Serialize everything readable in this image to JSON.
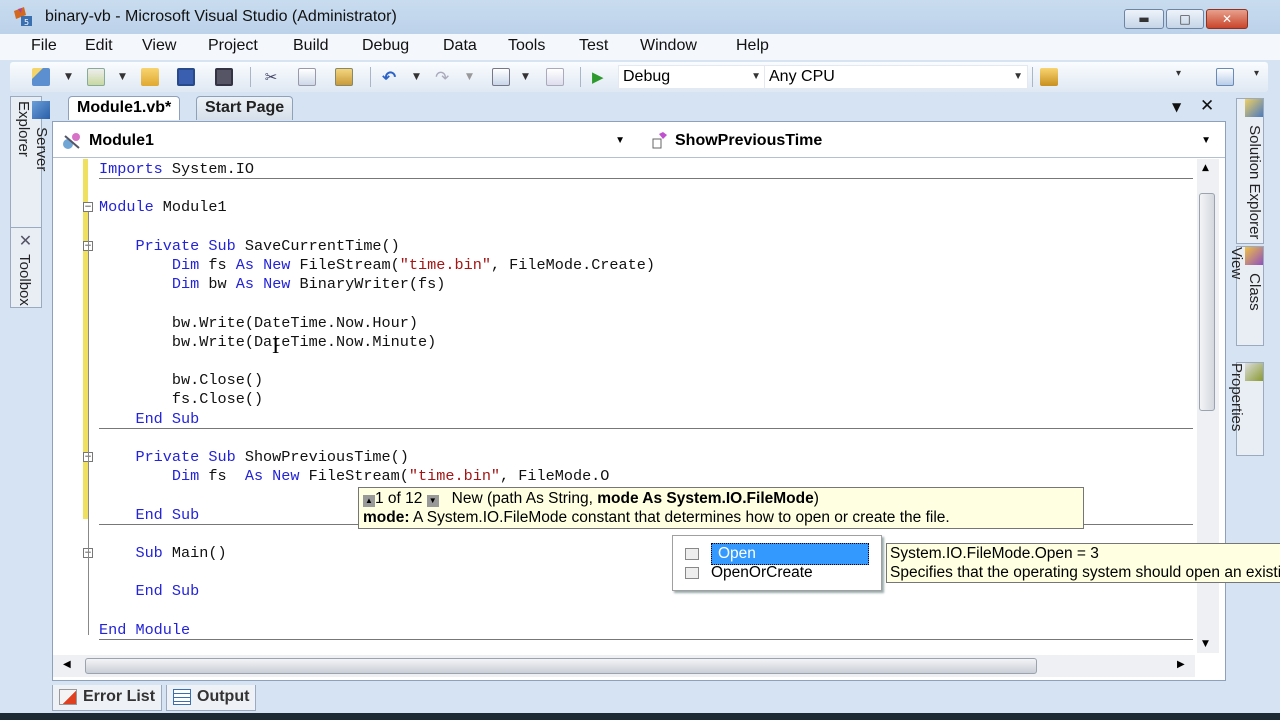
{
  "window": {
    "title": "binary-vb - Microsoft Visual Studio (Administrator)",
    "controls": {
      "minimize": "▬",
      "maximize": "□",
      "close": "✕"
    }
  },
  "menu": [
    "File",
    "Edit",
    "View",
    "Project",
    "Build",
    "Debug",
    "Data",
    "Tools",
    "Test",
    "Window",
    "Help"
  ],
  "toolbar": {
    "icons": [
      "new-project-icon",
      "add-item-icon",
      "open-file-icon",
      "save-icon",
      "save-all-icon",
      "cut-icon",
      "copy-icon",
      "paste-icon",
      "undo-icon",
      "redo-icon",
      "navigate-backward-icon",
      "navigate-forward-icon",
      "start-debug-icon",
      "find-in-files-icon"
    ],
    "configuration": "Debug",
    "platform": "Any CPU"
  },
  "left_dock": {
    "tabs": [
      "Server Explorer",
      "Toolbox"
    ]
  },
  "right_dock": {
    "tabs": [
      "Solution Explorer",
      "Class View",
      "Properties"
    ]
  },
  "doc_tabs": [
    {
      "label": "Module1.vb*",
      "active": true
    },
    {
      "label": "Start Page",
      "active": false
    }
  ],
  "nav": {
    "type_combo": "Module1",
    "member_combo": "ShowPreviousTime"
  },
  "code": {
    "lines": [
      [
        {
          "t": "Imports",
          "k": "kw"
        },
        {
          "t": " System.IO"
        }
      ],
      [],
      [
        {
          "t": "Module",
          "k": "kw"
        },
        {
          "t": " Module1"
        }
      ],
      [],
      [
        {
          "t": "    Private Sub",
          "k": "kw"
        },
        {
          "t": " SaveCurrentTime()"
        }
      ],
      [
        {
          "t": "        Dim",
          "k": "kw"
        },
        {
          "t": " fs "
        },
        {
          "t": "As New",
          "k": "kw"
        },
        {
          "t": " FileStream("
        },
        {
          "t": "\"time.bin\"",
          "k": "str"
        },
        {
          "t": ", FileMode.Create)"
        }
      ],
      [
        {
          "t": "        Dim",
          "k": "kw"
        },
        {
          "t": " bw "
        },
        {
          "t": "As New",
          "k": "kw"
        },
        {
          "t": " BinaryWriter(fs)"
        }
      ],
      [],
      [
        {
          "t": "        bw.Write(DateTime.Now.Hour)"
        }
      ],
      [
        {
          "t": "        bw.Write(DateTime.Now.Minute)"
        }
      ],
      [],
      [
        {
          "t": "        bw.Close()"
        }
      ],
      [
        {
          "t": "        fs.Close()"
        }
      ],
      [
        {
          "t": "    End Sub",
          "k": "kw"
        }
      ],
      [],
      [
        {
          "t": "    Private Sub",
          "k": "kw"
        },
        {
          "t": " ShowPreviousTime()"
        }
      ],
      [
        {
          "t": "        Dim",
          "k": "kw"
        },
        {
          "t": " fs  "
        },
        {
          "t": "As New",
          "k": "kw"
        },
        {
          "t": " FileStream("
        },
        {
          "t": "\"time.bin\"",
          "k": "str"
        },
        {
          "t": ", FileMode.O"
        }
      ],
      [],
      [
        {
          "t": "    End Sub",
          "k": "kw"
        }
      ],
      [],
      [
        {
          "t": "    Sub",
          "k": "kw"
        },
        {
          "t": " Main()"
        }
      ],
      [],
      [
        {
          "t": "    End Sub",
          "k": "kw"
        }
      ],
      [],
      [
        {
          "t": "End Module",
          "k": "kw"
        }
      ]
    ]
  },
  "param_tooltip": {
    "counter": "1 of 12",
    "signature_prefix": "New (path As String, ",
    "signature_bold": "mode As System.IO.FileMode",
    "signature_suffix": ")",
    "param_name": "mode:",
    "param_desc": " A System.IO.FileMode constant that determines how to open or create the file."
  },
  "completion": {
    "items": [
      {
        "label": "Open",
        "selected": true
      },
      {
        "label": "OpenOrCreate",
        "selected": false
      }
    ]
  },
  "member_tooltip": {
    "line1": "System.IO.FileMode.Open = 3",
    "line2": "Specifies that the operating system should open an existing file."
  },
  "bottom_tabs": [
    "Error List",
    "Output"
  ]
}
